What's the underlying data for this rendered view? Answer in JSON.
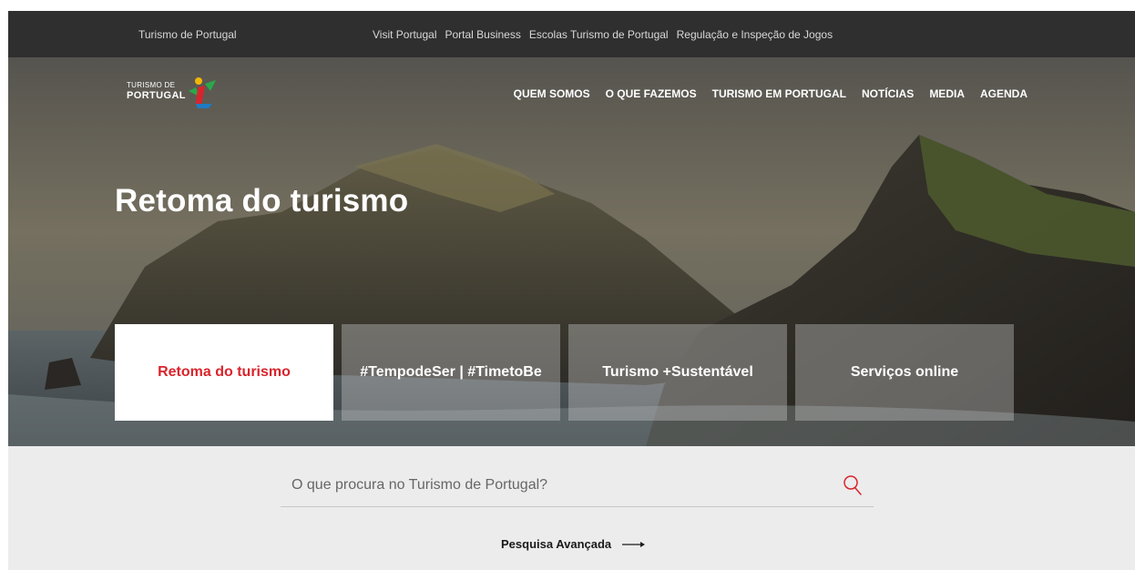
{
  "topbar": {
    "brand": "Turismo de Portugal",
    "links": [
      "Visit Portugal",
      "Portal Business",
      "Escolas Turismo de Portugal",
      "Regulação e Inspeção de Jogos"
    ]
  },
  "logo": {
    "line1": "TURISMO DE",
    "line2": "PORTUGAL"
  },
  "nav": [
    "QUEM SOMOS",
    "O QUE FAZEMOS",
    "TURISMO EM PORTUGAL",
    "NOTÍCIAS",
    "MEDIA",
    "AGENDA"
  ],
  "hero": {
    "title": "Retoma do turismo",
    "tiles": [
      "Retoma do turismo",
      "#TempodeSer | #TimetoBe",
      "Turismo +Sustentável",
      "Serviços online"
    ]
  },
  "search": {
    "placeholder": "O que procura no Turismo de Portugal?",
    "advanced_label": "Pesquisa Avançada"
  },
  "colors": {
    "accent": "#d8242c",
    "topbar": "#2f2f2f",
    "search_bg": "#ececec"
  },
  "icons": {
    "search": "search-icon",
    "arrow": "arrow-right-icon"
  }
}
